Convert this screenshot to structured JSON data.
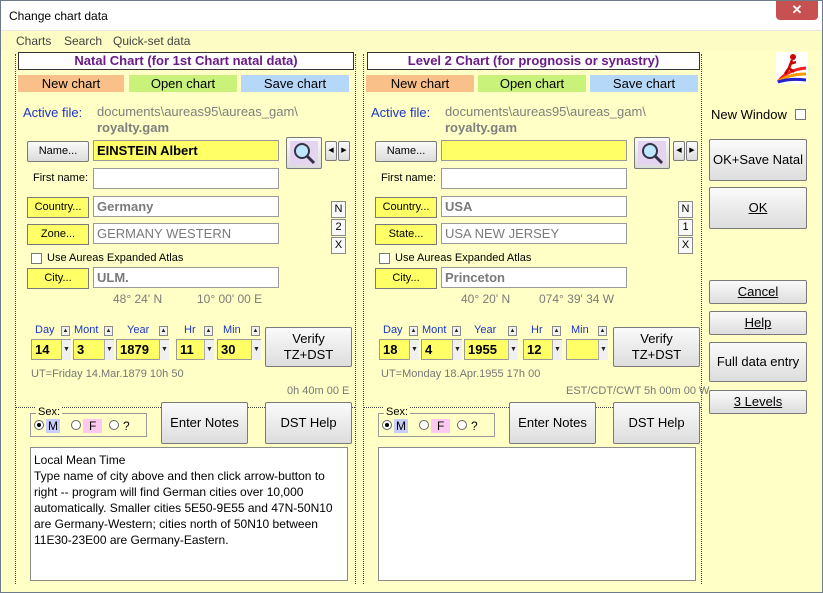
{
  "window": {
    "title": "Change chart data",
    "close_glyph": "✕"
  },
  "menu": [
    "Charts",
    "Search",
    "Quick-set data"
  ],
  "natal": {
    "panel_title": "Natal Chart (for 1st Chart natal data)",
    "new_chart": "New chart",
    "open_chart": "Open chart",
    "save_chart": "Save chart",
    "active_file_label": "Active file:",
    "active_path": "documents\\aureas95\\aureas_gam\\",
    "active_file": "royalty.gam",
    "name_btn": "Name...",
    "name_value": "EINSTEIN Albert",
    "first_name_label": "First name:",
    "first_name_value": "",
    "country_btn": "Country...",
    "country_value": "Germany",
    "zone_btn": "Zone...",
    "zone_value": "GERMANY WESTERN",
    "atlas_label": "Use Aureas Expanded Atlas",
    "city_btn": "City...",
    "city_value": "ULM.",
    "lat": "48° 24' N",
    "lon": "10° 00' 00 E",
    "day_lbl": "Day",
    "month_lbl": "Mont",
    "year_lbl": "Year",
    "hr_lbl": "Hr",
    "min_lbl": "Min",
    "day": "14",
    "month": "3",
    "year": "1879",
    "hr": "11",
    "min": "30",
    "verify_btn_1": "Verify",
    "verify_btn_2": "TZ+DST",
    "ut_text": "UT=Friday 14.Mar.1879 10h 50",
    "offset": "0h 40m 00 E",
    "sex_label": "Sex:",
    "sex_m": "M",
    "sex_f": "F",
    "sex_q": "?",
    "enter_notes": "Enter Notes",
    "dst_help": "DST Help",
    "nbtns": [
      "N",
      "2",
      "X"
    ],
    "notes_text": "Local Mean Time\nType name of city above and then click arrow-button to right -- program will find German cities over 10,000 automatically. Smaller cities 5E50-9E55 and 47N-50N10 are Germany-Western; cities north of 50N10 between 11E30-23E00 are Germany-Eastern."
  },
  "level2": {
    "panel_title": "Level 2 Chart (for prognosis or synastry)",
    "new_chart": "New chart",
    "open_chart": "Open chart",
    "save_chart": "Save chart",
    "active_file_label": "Active file:",
    "active_path": "documents\\aureas95\\aureas_gam\\",
    "active_file": "royalty.gam",
    "name_btn": "Name...",
    "name_value": "",
    "first_name_label": "First name:",
    "first_name_value": "",
    "country_btn": "Country...",
    "country_value": "USA",
    "state_btn": "State...",
    "state_value": "USA NEW JERSEY",
    "atlas_label": "Use Aureas Expanded Atlas",
    "city_btn": "City...",
    "city_value": "Princeton",
    "lat": "40° 20' N",
    "lon": "074° 39' 34 W",
    "day_lbl": "Day",
    "month_lbl": "Mont",
    "year_lbl": "Year",
    "hr_lbl": "Hr",
    "min_lbl": "Min",
    "day": "18",
    "month": "4",
    "year": "1955",
    "hr": "12",
    "min": "",
    "verify_btn_1": "Verify",
    "verify_btn_2": "TZ+DST",
    "ut_text": "UT=Monday 18.Apr.1955 17h 00",
    "offset": "EST/CDT/CWT 5h 00m 00 W",
    "sex_label": "Sex:",
    "sex_m": "M",
    "sex_f": "F",
    "sex_q": "?",
    "enter_notes": "Enter Notes",
    "dst_help": "DST Help",
    "nbtns": [
      "N",
      "1",
      "X"
    ],
    "notes_text": ""
  },
  "right": {
    "new_window": "New Window",
    "ok_save_natal": "OK+Save Natal",
    "ok": "OK",
    "cancel": "Cancel",
    "help": "Help",
    "full_data_entry": "Full data entry",
    "three_levels": "3 Levels"
  },
  "colors": {
    "bg": "#ffffc6",
    "new_chart": "#f9c08a",
    "open_chart": "#c8f27a",
    "save_chart": "#b6d8f8",
    "yellow": "#ffff66",
    "title_purple": "#6b1a86",
    "label_blue": "#1a36c8"
  }
}
